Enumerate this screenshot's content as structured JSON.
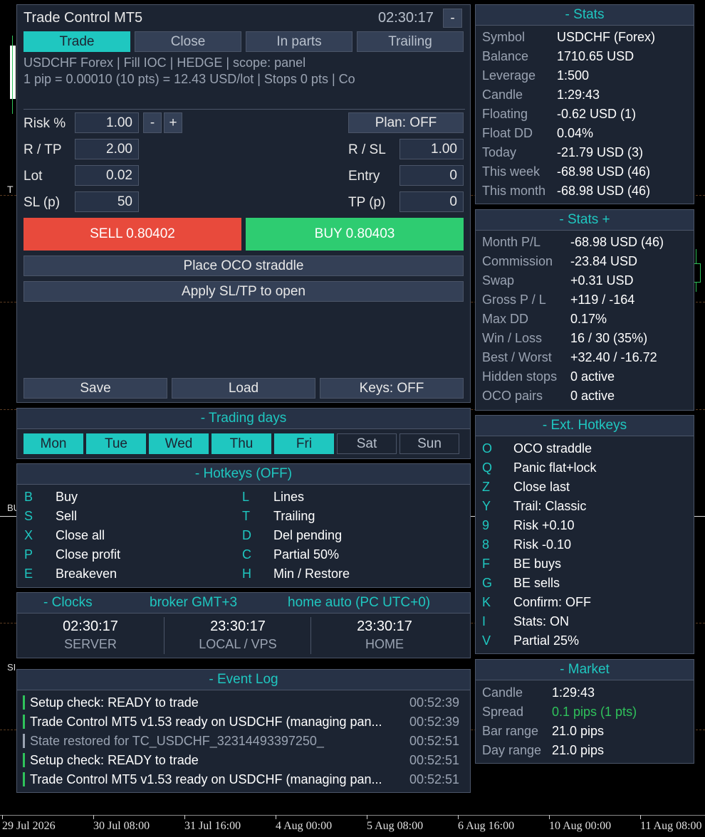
{
  "chart_bg": {
    "x_labels": [
      "29 Jul 2026",
      "30 Jul 08:00",
      "31 Jul 16:00",
      "4 Aug 00:00",
      "5 Aug 08:00",
      "6 Aug 16:00",
      "10 Aug 00:00",
      "11 Aug 08:00"
    ],
    "edge_frags": [
      "T",
      "BU",
      "SI"
    ]
  },
  "trade_panel": {
    "title": "Trade Control MT5",
    "time": "02:30:17",
    "minimize": "-",
    "tabs": [
      "Trade",
      "Close",
      "In parts",
      "Trailing"
    ],
    "info1": "USDCHF  Forex  |  Fill IOC  |  HEDGE  |  scope: panel",
    "info2": "1 pip = 0.00010 (10 pts) = 12.43 USD/lot  |  Stops 0 pts  |  Co",
    "risk_label": "Risk %",
    "risk_value": "1.00",
    "minus": "-",
    "plus": "+",
    "plan": "Plan: OFF",
    "rtp_label": "R / TP",
    "rtp_value": "2.00",
    "rsl_label": "R / SL",
    "rsl_value": "1.00",
    "lot_label": "Lot",
    "lot_value": "0.02",
    "entry_label": "Entry",
    "entry_value": "0",
    "sl_label": "SL (p)",
    "sl_value": "50",
    "tp_label": "TP (p)",
    "tp_value": "0",
    "sell": "SELL  0.80402",
    "buy": "BUY  0.80403",
    "oco": "Place OCO straddle",
    "apply": "Apply SL/TP to open",
    "save": "Save",
    "load": "Load",
    "keys": "Keys: OFF",
    "colors": {
      "sell": "#e84a3c",
      "buy": "#2ecc71",
      "accent": "#1fc7c0"
    }
  },
  "trading_days": {
    "title": "- Trading days",
    "days": [
      {
        "label": "Mon",
        "on": true
      },
      {
        "label": "Tue",
        "on": true
      },
      {
        "label": "Wed",
        "on": true
      },
      {
        "label": "Thu",
        "on": true
      },
      {
        "label": "Fri",
        "on": true
      },
      {
        "label": "Sat",
        "on": false
      },
      {
        "label": "Sun",
        "on": false
      }
    ]
  },
  "hotkeys": {
    "title": "- Hotkeys (OFF)",
    "left": [
      [
        "B",
        "Buy"
      ],
      [
        "S",
        "Sell"
      ],
      [
        "X",
        "Close all"
      ],
      [
        "P",
        "Close profit"
      ],
      [
        "E",
        "Breakeven"
      ]
    ],
    "right": [
      [
        "L",
        "Lines"
      ],
      [
        "T",
        "Trailing"
      ],
      [
        "D",
        "Del pending"
      ],
      [
        "C",
        "Partial 50%"
      ],
      [
        "H",
        "Min / Restore"
      ]
    ]
  },
  "clocks": {
    "title": "- Clocks",
    "broker": "broker GMT+3",
    "home": "home auto (PC UTC+0)",
    "items": [
      {
        "time": "02:30:17",
        "label": "SERVER"
      },
      {
        "time": "23:30:17",
        "label": "LOCAL / VPS"
      },
      {
        "time": "23:30:17",
        "label": "HOME"
      }
    ]
  },
  "event_log": {
    "title": "- Event Log",
    "entries": [
      {
        "text": "Setup check: READY to trade",
        "time": "00:52:39",
        "color": "#2fc25b",
        "dim": false
      },
      {
        "text": "Trade Control MT5 v1.53 ready on USDCHF (managing pan...",
        "time": "00:52:39",
        "color": "#2fc25b",
        "dim": false
      },
      {
        "text": "State restored for TC_USDCHF_32314493397250_",
        "time": "00:52:51",
        "color": "#9aa3b2",
        "dim": true
      },
      {
        "text": "Setup check: READY to trade",
        "time": "00:52:51",
        "color": "#2fc25b",
        "dim": false
      },
      {
        "text": "Trade Control MT5 v1.53 ready on USDCHF (managing pan...",
        "time": "00:52:51",
        "color": "#2fc25b",
        "dim": false
      }
    ]
  },
  "stats": {
    "title": "- Stats",
    "rows": [
      [
        "Symbol",
        "USDCHF  (Forex)"
      ],
      [
        "Balance",
        "1710.65 USD"
      ],
      [
        "Leverage",
        "1:500"
      ],
      [
        "Candle",
        "1:29:43"
      ],
      [
        "Floating",
        "-0.62 USD (1)"
      ],
      [
        "Float DD",
        "0.04%"
      ],
      [
        "Today",
        "-21.79 USD (3)"
      ],
      [
        "This week",
        "-68.98 USD (46)"
      ],
      [
        "This month",
        "-68.98 USD (46)"
      ]
    ]
  },
  "stats_plus": {
    "title": "- Stats +",
    "rows": [
      [
        "Month P/L",
        "-68.98 USD (46)"
      ],
      [
        "Commission",
        "-23.84 USD"
      ],
      [
        "Swap",
        "+0.31 USD"
      ],
      [
        "Gross P / L",
        "+119 / -164"
      ],
      [
        "Max DD",
        "0.17%"
      ],
      [
        "Win / Loss",
        "16 / 30  (35%)"
      ],
      [
        "Best / Worst",
        "+32.40 / -16.72"
      ],
      [
        "Hidden stops",
        "0 active"
      ],
      [
        "OCO pairs",
        "0 active"
      ]
    ]
  },
  "ext_hotkeys": {
    "title": "- Ext. Hotkeys",
    "rows": [
      [
        "O",
        "OCO straddle"
      ],
      [
        "Q",
        "Panic flat+lock"
      ],
      [
        "Z",
        "Close last"
      ],
      [
        "Y",
        "Trail: Classic"
      ],
      [
        "9",
        "Risk +0.10"
      ],
      [
        "8",
        "Risk -0.10"
      ],
      [
        "F",
        "BE buys"
      ],
      [
        "G",
        "BE sells"
      ],
      [
        "K",
        "Confirm: OFF"
      ],
      [
        "I",
        "Stats: ON"
      ],
      [
        "V",
        "Partial 25%"
      ]
    ]
  },
  "market": {
    "title": "- Market",
    "rows": [
      {
        "k": "Candle",
        "v": "1:29:43",
        "green": false
      },
      {
        "k": "Spread",
        "v": "0.1 pips (1 pts)",
        "green": true
      },
      {
        "k": "Bar range",
        "v": "21.0 pips",
        "green": false
      },
      {
        "k": "Day range",
        "v": "21.0 pips",
        "green": false
      }
    ]
  }
}
